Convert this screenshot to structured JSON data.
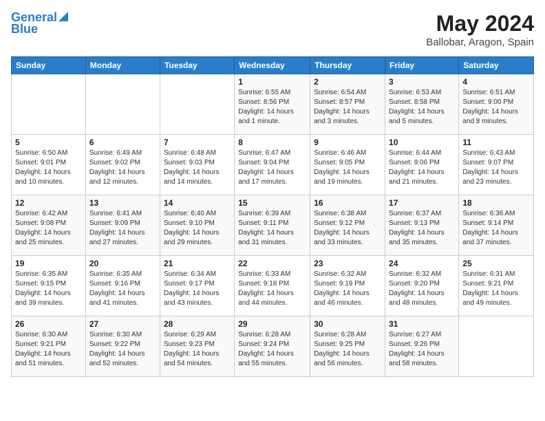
{
  "header": {
    "logo_line1": "General",
    "logo_line2": "Blue",
    "month": "May 2024",
    "location": "Ballobar, Aragon, Spain"
  },
  "weekdays": [
    "Sunday",
    "Monday",
    "Tuesday",
    "Wednesday",
    "Thursday",
    "Friday",
    "Saturday"
  ],
  "weeks": [
    [
      {
        "day": "",
        "info": ""
      },
      {
        "day": "",
        "info": ""
      },
      {
        "day": "",
        "info": ""
      },
      {
        "day": "1",
        "info": "Sunrise: 6:55 AM\nSunset: 8:56 PM\nDaylight: 14 hours\nand 1 minute."
      },
      {
        "day": "2",
        "info": "Sunrise: 6:54 AM\nSunset: 8:57 PM\nDaylight: 14 hours\nand 3 minutes."
      },
      {
        "day": "3",
        "info": "Sunrise: 6:53 AM\nSunset: 8:58 PM\nDaylight: 14 hours\nand 5 minutes."
      },
      {
        "day": "4",
        "info": "Sunrise: 6:51 AM\nSunset: 9:00 PM\nDaylight: 14 hours\nand 8 minutes."
      }
    ],
    [
      {
        "day": "5",
        "info": "Sunrise: 6:50 AM\nSunset: 9:01 PM\nDaylight: 14 hours\nand 10 minutes."
      },
      {
        "day": "6",
        "info": "Sunrise: 6:49 AM\nSunset: 9:02 PM\nDaylight: 14 hours\nand 12 minutes."
      },
      {
        "day": "7",
        "info": "Sunrise: 6:48 AM\nSunset: 9:03 PM\nDaylight: 14 hours\nand 14 minutes."
      },
      {
        "day": "8",
        "info": "Sunrise: 6:47 AM\nSunset: 9:04 PM\nDaylight: 14 hours\nand 17 minutes."
      },
      {
        "day": "9",
        "info": "Sunrise: 6:46 AM\nSunset: 9:05 PM\nDaylight: 14 hours\nand 19 minutes."
      },
      {
        "day": "10",
        "info": "Sunrise: 6:44 AM\nSunset: 9:06 PM\nDaylight: 14 hours\nand 21 minutes."
      },
      {
        "day": "11",
        "info": "Sunrise: 6:43 AM\nSunset: 9:07 PM\nDaylight: 14 hours\nand 23 minutes."
      }
    ],
    [
      {
        "day": "12",
        "info": "Sunrise: 6:42 AM\nSunset: 9:08 PM\nDaylight: 14 hours\nand 25 minutes."
      },
      {
        "day": "13",
        "info": "Sunrise: 6:41 AM\nSunset: 9:09 PM\nDaylight: 14 hours\nand 27 minutes."
      },
      {
        "day": "14",
        "info": "Sunrise: 6:40 AM\nSunset: 9:10 PM\nDaylight: 14 hours\nand 29 minutes."
      },
      {
        "day": "15",
        "info": "Sunrise: 6:39 AM\nSunset: 9:11 PM\nDaylight: 14 hours\nand 31 minutes."
      },
      {
        "day": "16",
        "info": "Sunrise: 6:38 AM\nSunset: 9:12 PM\nDaylight: 14 hours\nand 33 minutes."
      },
      {
        "day": "17",
        "info": "Sunrise: 6:37 AM\nSunset: 9:13 PM\nDaylight: 14 hours\nand 35 minutes."
      },
      {
        "day": "18",
        "info": "Sunrise: 6:36 AM\nSunset: 9:14 PM\nDaylight: 14 hours\nand 37 minutes."
      }
    ],
    [
      {
        "day": "19",
        "info": "Sunrise: 6:35 AM\nSunset: 9:15 PM\nDaylight: 14 hours\nand 39 minutes."
      },
      {
        "day": "20",
        "info": "Sunrise: 6:35 AM\nSunset: 9:16 PM\nDaylight: 14 hours\nand 41 minutes."
      },
      {
        "day": "21",
        "info": "Sunrise: 6:34 AM\nSunset: 9:17 PM\nDaylight: 14 hours\nand 43 minutes."
      },
      {
        "day": "22",
        "info": "Sunrise: 6:33 AM\nSunset: 9:18 PM\nDaylight: 14 hours\nand 44 minutes."
      },
      {
        "day": "23",
        "info": "Sunrise: 6:32 AM\nSunset: 9:19 PM\nDaylight: 14 hours\nand 46 minutes."
      },
      {
        "day": "24",
        "info": "Sunrise: 6:32 AM\nSunset: 9:20 PM\nDaylight: 14 hours\nand 48 minutes."
      },
      {
        "day": "25",
        "info": "Sunrise: 6:31 AM\nSunset: 9:21 PM\nDaylight: 14 hours\nand 49 minutes."
      }
    ],
    [
      {
        "day": "26",
        "info": "Sunrise: 6:30 AM\nSunset: 9:21 PM\nDaylight: 14 hours\nand 51 minutes."
      },
      {
        "day": "27",
        "info": "Sunrise: 6:30 AM\nSunset: 9:22 PM\nDaylight: 14 hours\nand 52 minutes."
      },
      {
        "day": "28",
        "info": "Sunrise: 6:29 AM\nSunset: 9:23 PM\nDaylight: 14 hours\nand 54 minutes."
      },
      {
        "day": "29",
        "info": "Sunrise: 6:28 AM\nSunset: 9:24 PM\nDaylight: 14 hours\nand 55 minutes."
      },
      {
        "day": "30",
        "info": "Sunrise: 6:28 AM\nSunset: 9:25 PM\nDaylight: 14 hours\nand 56 minutes."
      },
      {
        "day": "31",
        "info": "Sunrise: 6:27 AM\nSunset: 9:26 PM\nDaylight: 14 hours\nand 58 minutes."
      },
      {
        "day": "",
        "info": ""
      }
    ]
  ]
}
